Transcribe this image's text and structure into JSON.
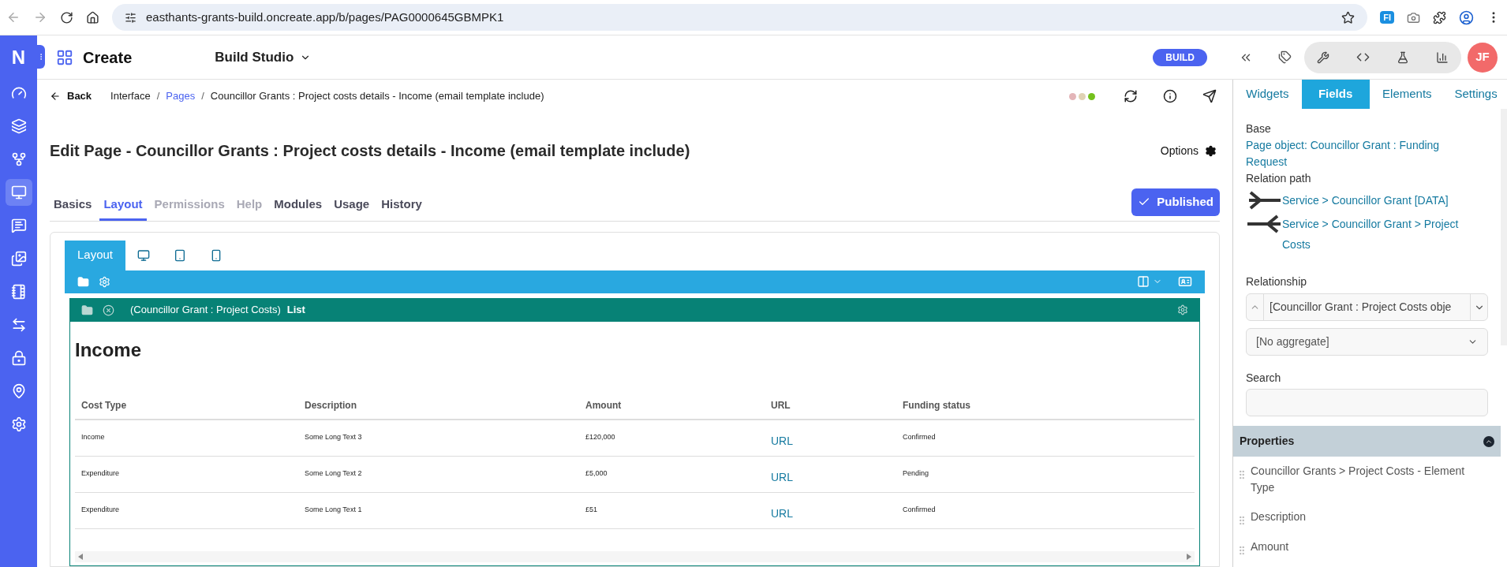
{
  "browser": {
    "url": "easthants-grants-build.oncreate.app/b/pages/PAG0000645GBMPK1",
    "extension_label": "FI"
  },
  "app_header": {
    "brand": "Create",
    "studio": "Build Studio",
    "mode_badge": "BUILD",
    "avatar": "JF"
  },
  "sidebar": {
    "logo": "N",
    "items": [
      {
        "kind": "gauge",
        "selected": false
      },
      {
        "kind": "layers",
        "selected": false
      },
      {
        "kind": "fork",
        "selected": false
      },
      {
        "kind": "monitor",
        "selected": true
      },
      {
        "kind": "message",
        "selected": false
      },
      {
        "kind": "image",
        "selected": false
      },
      {
        "kind": "notebook",
        "selected": false
      },
      {
        "kind": "arrows",
        "selected": false
      },
      {
        "kind": "lock",
        "selected": false
      },
      {
        "kind": "pin",
        "selected": false
      },
      {
        "kind": "settings",
        "selected": false
      }
    ]
  },
  "breadcrumb": {
    "back": "Back",
    "separator": "/",
    "items": [
      {
        "label": "Interface",
        "link": false
      },
      {
        "label": "Pages",
        "link": true
      },
      {
        "label": "Councillor Grants : Project costs details - Income (email template include)",
        "link": false
      }
    ]
  },
  "status_dots": [
    {
      "color": "#e3b5b8"
    },
    {
      "color": "#e0d2b4"
    },
    {
      "color": "#74c11c"
    }
  ],
  "page_title": "Edit Page - Councillor Grants : Project costs details - Income (email template include)",
  "options_label": "Options",
  "tabs": [
    {
      "label": "Basics",
      "selected": false,
      "disabled": false
    },
    {
      "label": "Layout",
      "selected": true,
      "disabled": false
    },
    {
      "label": "Permissions",
      "selected": false,
      "disabled": true
    },
    {
      "label": "Help",
      "selected": false,
      "disabled": true
    },
    {
      "label": "Modules",
      "selected": false,
      "disabled": false
    },
    {
      "label": "Usage",
      "selected": false,
      "disabled": false
    },
    {
      "label": "History",
      "selected": false,
      "disabled": false
    }
  ],
  "publish_button": "Published",
  "layout_editor": {
    "tabs": [
      {
        "kind": "text",
        "label": "Layout",
        "selected": true
      },
      {
        "kind": "desktop",
        "selected": false
      },
      {
        "kind": "tablet",
        "selected": false
      },
      {
        "kind": "phone",
        "selected": false
      }
    ],
    "module": {
      "source": "(Councillor Grant : Project Costs)",
      "type": "List"
    },
    "heading": "Income",
    "table": {
      "columns": [
        "Cost Type",
        "Description",
        "Amount",
        "URL",
        "Funding status"
      ],
      "rows": [
        [
          "Income",
          "Some Long Text 3",
          "£120,000",
          "URL",
          "Confirmed"
        ],
        [
          "Expenditure",
          "Some Long Text 2",
          "£5,000",
          "URL",
          "Pending"
        ],
        [
          "Expenditure",
          "Some Long Text 1",
          "£51",
          "URL",
          "Confirmed"
        ]
      ]
    }
  },
  "right_panel": {
    "tabs": [
      {
        "label": "Widgets",
        "selected": false
      },
      {
        "label": "Fields",
        "selected": true
      },
      {
        "label": "Elements",
        "selected": false
      },
      {
        "label": "Settings",
        "selected": false
      }
    ],
    "base_label": "Base",
    "base_link": "Page object: Councillor Grant : Funding Request",
    "relation_label": "Relation path",
    "relations": [
      {
        "kind": "forward",
        "label": "Service > Councillor Grant [DATA]"
      },
      {
        "kind": "backward",
        "label": "Service > Councillor Grant > Project Costs"
      }
    ],
    "relationship_label": "Relationship",
    "relationship_value": "[Councillor Grant : Project Costs obje",
    "aggregate_value": "[No aggregate]",
    "search_label": "Search",
    "properties_title": "Properties",
    "properties": [
      "Councillor Grants > Project Costs - Element Type",
      "Description",
      "Amount"
    ]
  }
}
